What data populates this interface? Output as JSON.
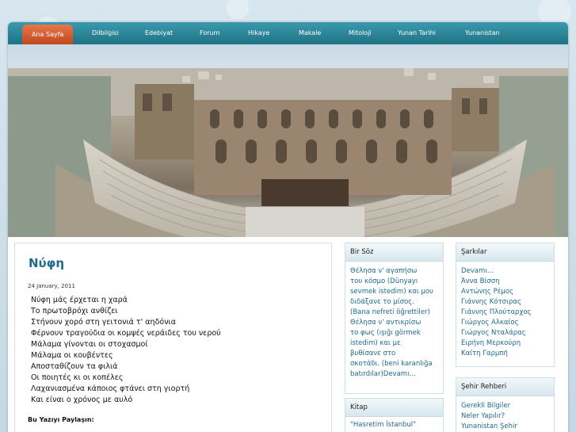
{
  "nav": {
    "items": [
      "Ana Sayfa",
      "Dilbilgisi",
      "Edebiyat",
      "Forum",
      "Hikaye",
      "Makale",
      "Mitoloji",
      "Yunan Tarihi",
      "Yunanistan"
    ],
    "active_color": "#d95a2b",
    "bar_color": "#2a8799"
  },
  "post": {
    "title": "Νύφη",
    "date": "24 January, 2011",
    "lines": [
      "Νύφη μάς έρχεται η χαρά",
      "Το πρωτοβρόχι ανθίζει",
      "Στήνουν χορό στη γειτονιά τ' αηδόνια",
      "Φέρνουν τραγούδια οι κομψές νεράιδες του νερού",
      "Μάλαμα γίνονται οι στοχασμοί",
      "Μάλαμα οι κουβέντες",
      "Αποσταθίζουν τα φιλιά",
      "Οι ποιητές κι οι κοπέλες",
      "Λαχανιασμένα κάποιος φτάνει στη γιορτή",
      "Και είναι ο χρόνος με αυλό"
    ],
    "share_label": "Bu Yazıyı Paylaşın:"
  },
  "bir_soz": {
    "title": "Bir Söz",
    "lines": [
      "Θέλησα ν' αγαπήσω",
      "του κόσμο (Dünyayı",
      "sevmek istedim) και μου",
      "διδάξανε το μίσος.",
      "(Bana nefreti öğrettiler)",
      "Θέλησα ν' αντικρίσω",
      "το φως (ışığı görmek",
      "istedim) και με",
      "βυθίσανε στο",
      "σκοτάδι. (beni karanlığa",
      "batırdılar)Devamı…"
    ]
  },
  "kitap": {
    "title": "Kitap",
    "lines": [
      "\"Hasretim İstanbul\""
    ]
  },
  "sarkilar": {
    "title": "Şarkılar",
    "items": [
      "Devamı…",
      "Άννα Βίσση",
      "Αντώνης Ρέμος",
      "Γιάννης Κότσιρας",
      "Γιάννης Πλούταρχος",
      "Γιώργος Αλκαίος",
      "Γιώργος Νταλάρας",
      "Ειρήνη Μερκούρη",
      "Καίτη Γαρμπή"
    ]
  },
  "sehir": {
    "title": "Şehir Rehberi",
    "items": [
      "Gerekli Bilgiler",
      "Neler Yapılır?",
      "Yunanistan Şehir"
    ]
  }
}
